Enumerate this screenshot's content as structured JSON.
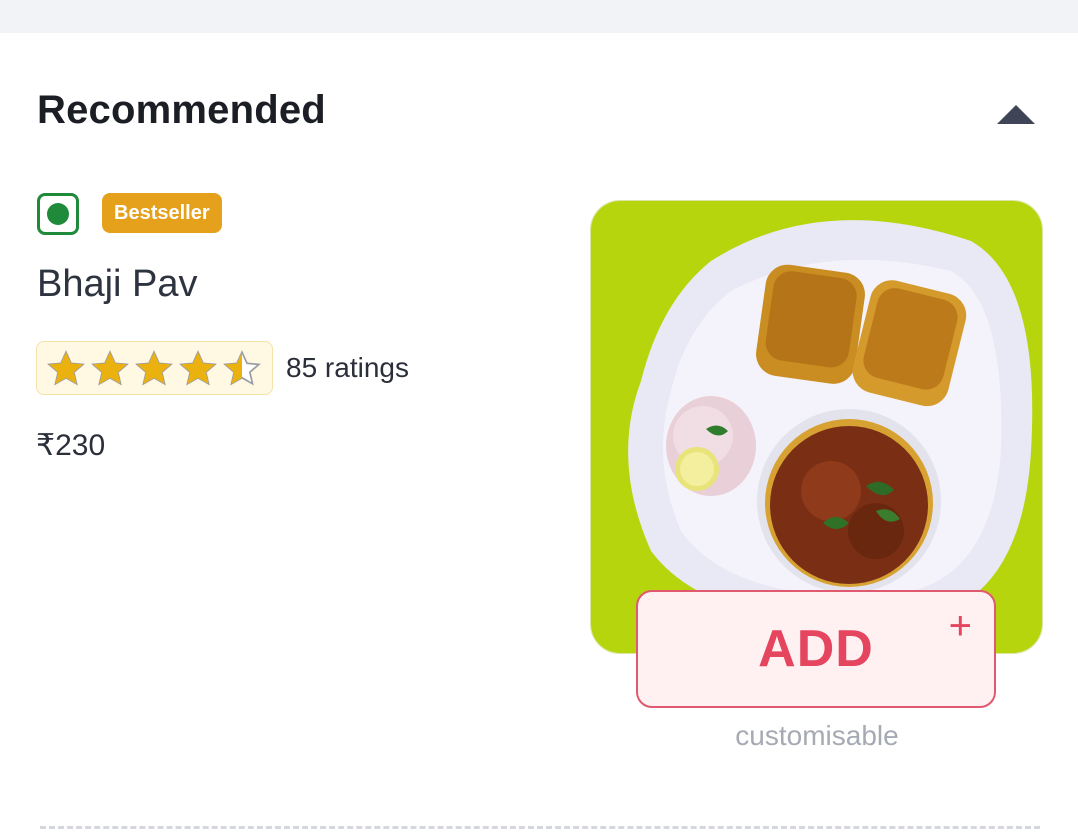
{
  "section": {
    "title": "Recommended",
    "collapse_icon": "triangle-up-icon"
  },
  "item": {
    "veg_indicator": "veg-icon",
    "badge": "Bestseller",
    "name": "Bhaji Pav",
    "rating_stars": 4.5,
    "rating_max": 5,
    "ratings_count": "85 ratings",
    "price": "₹230",
    "add_label": "ADD",
    "add_plus": "+",
    "customisable_text": "customisable"
  },
  "colors": {
    "veg_green": "#1f8a3a",
    "badge_bg": "#e5a11c",
    "star": "#ebb20f",
    "add_accent": "#e5455f"
  }
}
